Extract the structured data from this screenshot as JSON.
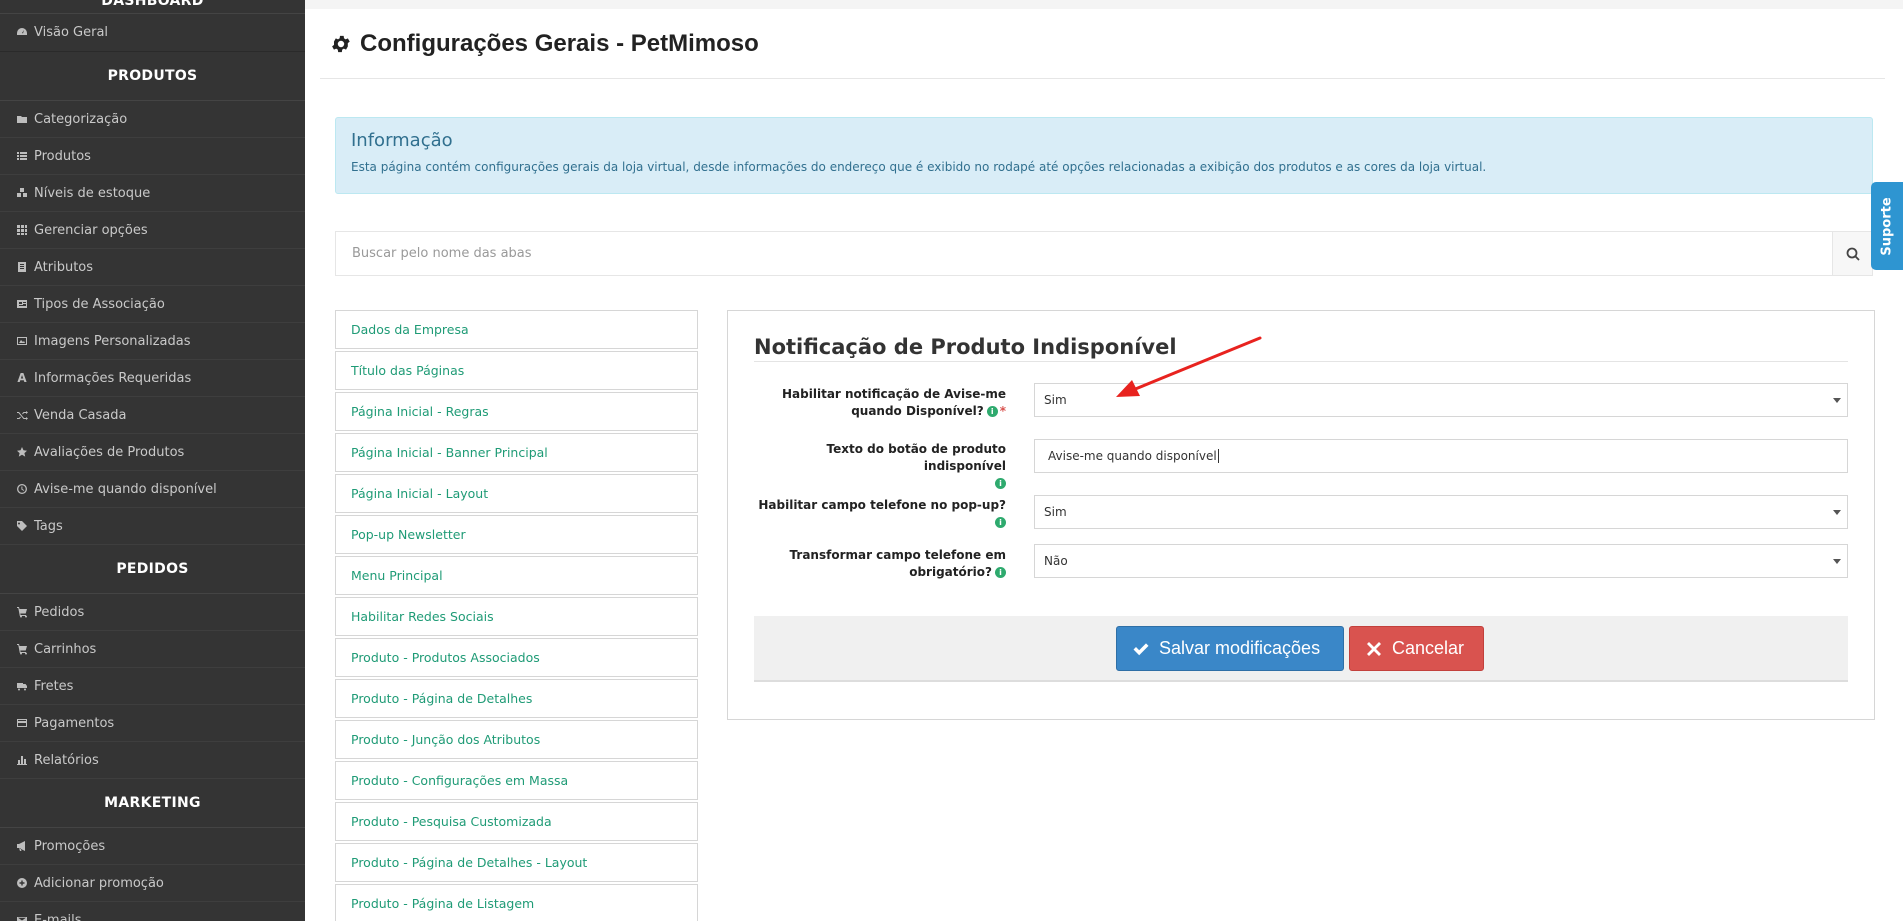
{
  "sidebar": {
    "sections": {
      "dashboard": "DASHBOARD",
      "produtos": "PRODUTOS",
      "pedidos": "PEDIDOS",
      "marketing": "MARKETING"
    },
    "dashboard_items": [
      "Visão Geral"
    ],
    "produtos_items": [
      "Categorização",
      "Produtos",
      "Níveis de estoque",
      "Gerenciar opções",
      "Atributos",
      "Tipos de Associação",
      "Imagens Personalizadas",
      "Informações Requeridas",
      "Venda Casada",
      "Avaliações de Produtos",
      "Avise-me quando disponível",
      "Tags"
    ],
    "pedidos_items": [
      "Pedidos",
      "Carrinhos",
      "Fretes",
      "Pagamentos",
      "Relatórios"
    ],
    "marketing_items": [
      "Promoções",
      "Adicionar promoção",
      "E-mails"
    ]
  },
  "header": {
    "title": "Configurações Gerais - PetMimoso"
  },
  "info": {
    "title": "Informação",
    "text": "Esta página contém configurações gerais da loja virtual, desde informações do endereço que é exibido no rodapé até opções relacionadas a exibição dos produtos e as cores da loja virtual."
  },
  "search": {
    "placeholder": "Buscar pelo nome das abas"
  },
  "support": {
    "label": "Suporte"
  },
  "tabs": [
    "Dados da Empresa",
    "Título das Páginas",
    "Página Inicial - Regras",
    "Página Inicial - Banner Principal",
    "Página Inicial - Layout",
    "Pop-up Newsletter",
    "Menu Principal",
    "Habilitar Redes Sociais",
    "Produto - Produtos Associados",
    "Produto - Página de Detalhes",
    "Produto - Junção dos Atributos",
    "Produto - Configurações em Massa",
    "Produto - Pesquisa Customizada",
    "Produto - Página de Detalhes - Layout",
    "Produto - Página de Listagem"
  ],
  "form": {
    "title": "Notificação de Produto Indisponível",
    "fields": {
      "enable_notify": {
        "label_line1": "Habilitar notificação de Avise-me",
        "label_line2": "quando Disponível?",
        "value": "Sim"
      },
      "button_text": {
        "label_line1": "Texto do botão de produto indisponível",
        "value": "Avise-me quando disponível"
      },
      "phone_popup": {
        "label_line1": "Habilitar campo telefone no pop-up?",
        "value": "Sim"
      },
      "phone_required": {
        "label_line1": "Transformar campo telefone em",
        "label_line2": "obrigatório?",
        "value": "Não"
      }
    },
    "save_label": "Salvar modificações",
    "cancel_label": "Cancelar"
  },
  "colors": {
    "sidebar_bg": "#343434",
    "link_green": "#1f9b76",
    "info_bg": "#d9edf7",
    "save_blue": "#3a87c8",
    "cancel_red": "#d9534f",
    "support_blue": "#2e95d1",
    "annotation_red": "#e8231f"
  }
}
